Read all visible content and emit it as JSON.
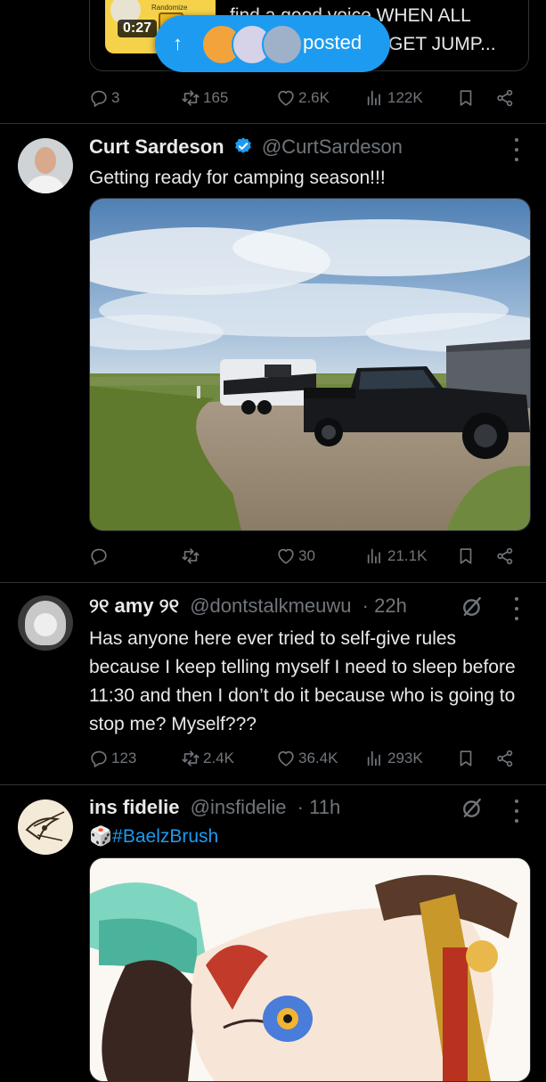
{
  "top_tweet": {
    "duration": "0:27",
    "thumb_label": "Randomize",
    "text_line1": "find a good voice WHEN ALL",
    "text_line2": "GET JUMP...",
    "actions": {
      "replies": "3",
      "reposts": "165",
      "likes": "2.6K",
      "views": "122K"
    }
  },
  "new_posts_pill": {
    "label": "posted"
  },
  "tweets": [
    {
      "name": "Curt Sardeson",
      "handle": "@CurtSardeson",
      "verified": true,
      "text": "Getting ready for camping season!!!",
      "actions": {
        "replies": "",
        "reposts": "",
        "likes": "30",
        "views": "21.1K"
      }
    },
    {
      "name": "୨୧ amy ୨୧",
      "handle": "@dontstalkmeuwu",
      "time": "· 22h",
      "text": "Has anyone here ever tried to self-give rules because I keep telling myself I need to sleep before 11:30 and then I don’t do it because who is going to stop me? Myself???",
      "actions": {
        "replies": "123",
        "reposts": "2.4K",
        "likes": "36.4K",
        "views": "293K"
      }
    },
    {
      "name": "ins fidelie",
      "handle": "@insfidelie",
      "time": "· 11h",
      "emoji": "🎲",
      "hashtag": "#BaelzBrush"
    }
  ],
  "colors": {
    "background": "#000000",
    "text": "#e7e9ea",
    "muted": "#71767b",
    "accent": "#1d9bf0",
    "divider": "#2f3336"
  }
}
